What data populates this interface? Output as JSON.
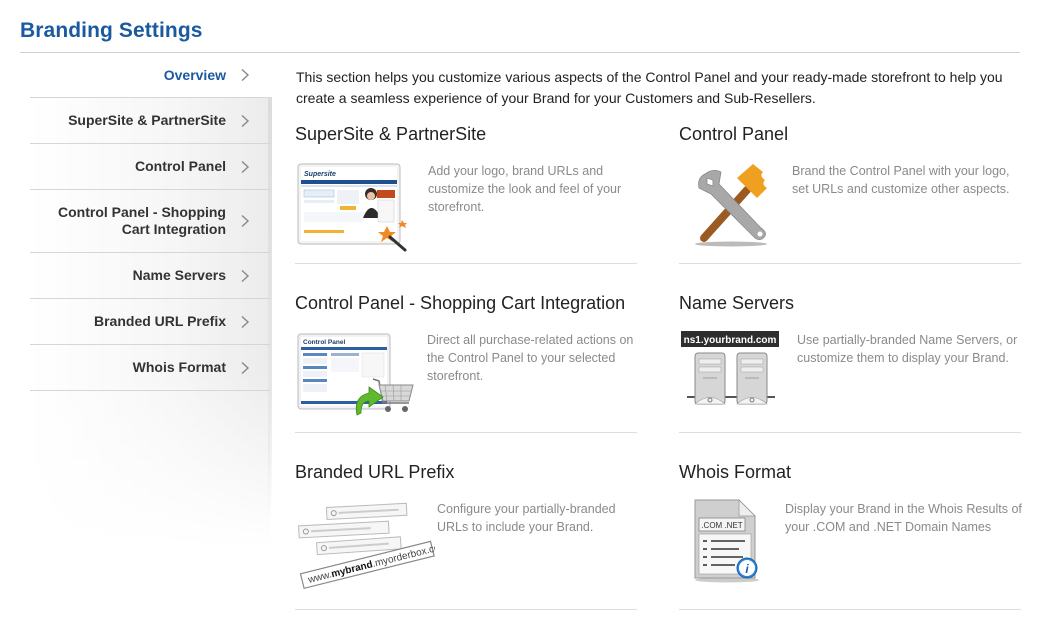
{
  "page": {
    "title": "Branding Settings"
  },
  "sidebar": {
    "items": [
      {
        "label": "Overview",
        "active": true
      },
      {
        "label": "SuperSite & PartnerSite",
        "active": false
      },
      {
        "label": "Control Panel",
        "active": false
      },
      {
        "label_line1": "Control Panel - Shopping",
        "label_line2": "Cart Integration",
        "active": false
      },
      {
        "label": "Name Servers",
        "active": false
      },
      {
        "label": "Branded URL Prefix",
        "active": false
      },
      {
        "label": "Whois Format",
        "active": false
      }
    ]
  },
  "main": {
    "intro": "This section helps you customize various aspects of the Control Panel and your ready-made storefront to help you create a seamless experience of your Brand for your Customers and Sub-Resellers.",
    "cards": [
      {
        "title": "SuperSite & PartnerSite",
        "icon": "supersite-storefront-icon",
        "description": "Add your logo, brand URLs and customize the look and feel of your storefront.",
        "icon_text": "Supersite"
      },
      {
        "title": "Control Panel",
        "icon": "wrench-hammer-icon",
        "description": "Brand the Control Panel with your logo, set URLs and customize other aspects."
      },
      {
        "title": "Control Panel - Shopping Cart Integration",
        "icon": "shopping-cart-integration-icon",
        "description": "Direct all purchase-related actions on the Control Panel to your selected storefront.",
        "icon_text": "Control Panel"
      },
      {
        "title": "Name Servers",
        "icon": "name-servers-icon",
        "description": "Use partially-branded Name Servers, or customize them to display your Brand.",
        "icon_text": "ns1.yourbrand.com"
      },
      {
        "title": "Branded URL Prefix",
        "icon": "branded-url-icon",
        "description": "Configure your partially-branded URLs to include your Brand.",
        "icon_text_prefix": "www.",
        "icon_text_brand": "mybrand",
        "icon_text_suffix": ".myorderbox.com"
      },
      {
        "title": "Whois Format",
        "icon": "whois-document-icon",
        "description": "Display your Brand in the Whois Results of your .COM and .NET Domain Names",
        "icon_text": ".COM .NET"
      }
    ]
  },
  "colors": {
    "brand_blue": "#1a5aa0",
    "hammer_orange": "#f0a020",
    "text_dark": "#222222",
    "text_muted": "#8a8a8a"
  }
}
